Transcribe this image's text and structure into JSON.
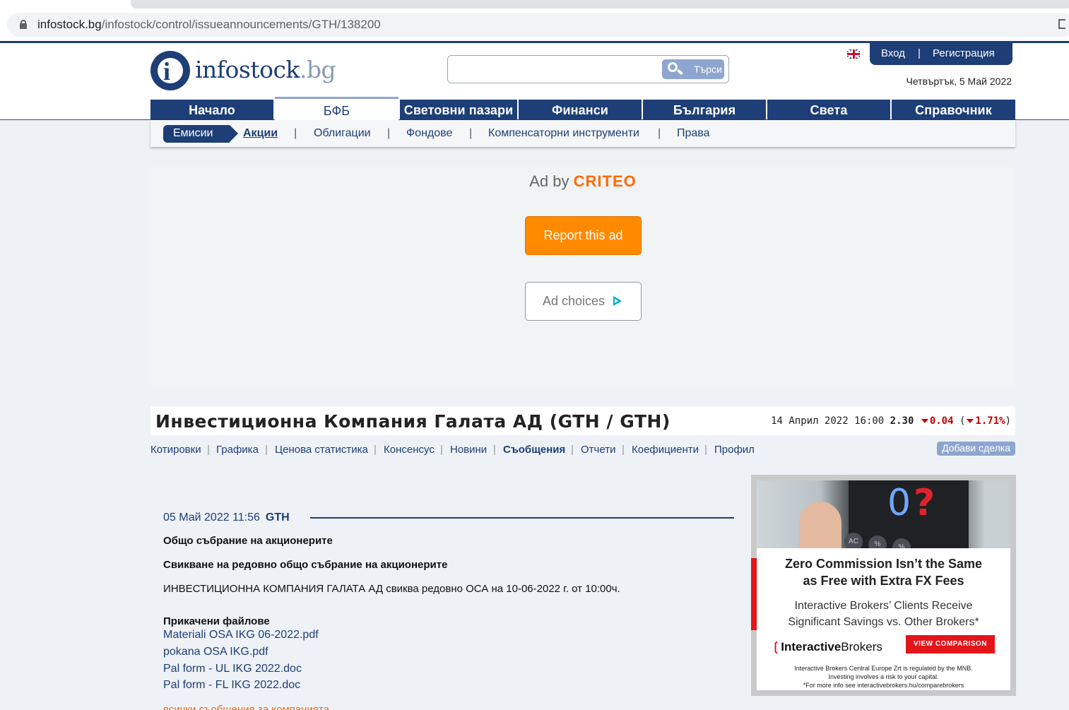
{
  "browser": {
    "url_host": "infostock.bg",
    "url_path": "/infostock/control/issueannouncements/GTH/138200"
  },
  "header": {
    "logo_text": "infostock",
    "logo_tld": ".bg",
    "search_button": "Търси",
    "search_placeholder": "",
    "login": "Вход",
    "login_sep": "|",
    "register": "Регистрация",
    "date": "Четвъртък, 5 Май 2022"
  },
  "main_nav": [
    {
      "label": "Начало"
    },
    {
      "label": "БФБ",
      "active": true
    },
    {
      "label": "Световни пазари"
    },
    {
      "label": "Финанси"
    },
    {
      "label": "България"
    },
    {
      "label": "Света"
    },
    {
      "label": "Справочник"
    }
  ],
  "sub_nav": {
    "section": "Емисии",
    "items": [
      "Акции",
      "Облигации",
      "Фондове",
      "Компенсаторни инструменти",
      "Права"
    ],
    "separator": "|"
  },
  "ad": {
    "ad_by": "Ad by",
    "brand": "CRITEO",
    "report": "Report this ad",
    "choices": "Ad choices"
  },
  "company": {
    "title": "Инвестиционна Компания Галата АД (GTH / GTH)",
    "quote_date": "14 Април 2022 16:00",
    "price": "2.30",
    "change": "0.04",
    "change_pct": "1.71%"
  },
  "tabs": {
    "items": [
      "Котировки",
      "Графика",
      "Ценова статистика",
      "Консенсус",
      "Новини",
      "Съобщения",
      "Отчети",
      "Коефициенти",
      "Профил"
    ],
    "active": "Съобщения",
    "add_deal": "Добави сделка"
  },
  "announcement": {
    "datetime": "05 Май 2022 11:56",
    "ticker": "GTH",
    "heading": "Общо събрание на акционерите",
    "subheading": "Свикване на редовно общо събрание на акционерите",
    "body": "ИНВЕСТИЦИОННА КОМПАНИЯ ГАЛАТА АД свиква редовно ОСА на 10-06-2022 г. от 10:00ч.",
    "files_label": "Прикачени файлове",
    "files": [
      "Materiali OSA IKG 06-2022.pdf",
      "pokana OSA IKG.pdf",
      "Pal form - UL IKG 2022.doc",
      "Pal form - FL IKG 2022.doc"
    ],
    "more_link": "всички съобщения за компанията"
  },
  "broker_ad": {
    "headline_1": "Zero Commission Isn’t the Same",
    "headline_2": "as Free with Extra FX Fees",
    "sub_1": "Interactive Brokers’ Clients Receive",
    "sub_2": "Significant Savings vs. Other Brokers*",
    "logo_a": "Interactive",
    "logo_b": "Brokers",
    "cta": "VIEW COMPARISON",
    "fine_1": "Interactive Brokers Central Europe Zrt is regulated by the MNB.",
    "fine_2": "Investing involves a risk to your capital.",
    "fine_3": "*For more info see interactivebrokers.hu/comparebrokers",
    "screen_zero": "0",
    "screen_q": "?",
    "keys": [
      "AC",
      "%",
      "%"
    ]
  }
}
